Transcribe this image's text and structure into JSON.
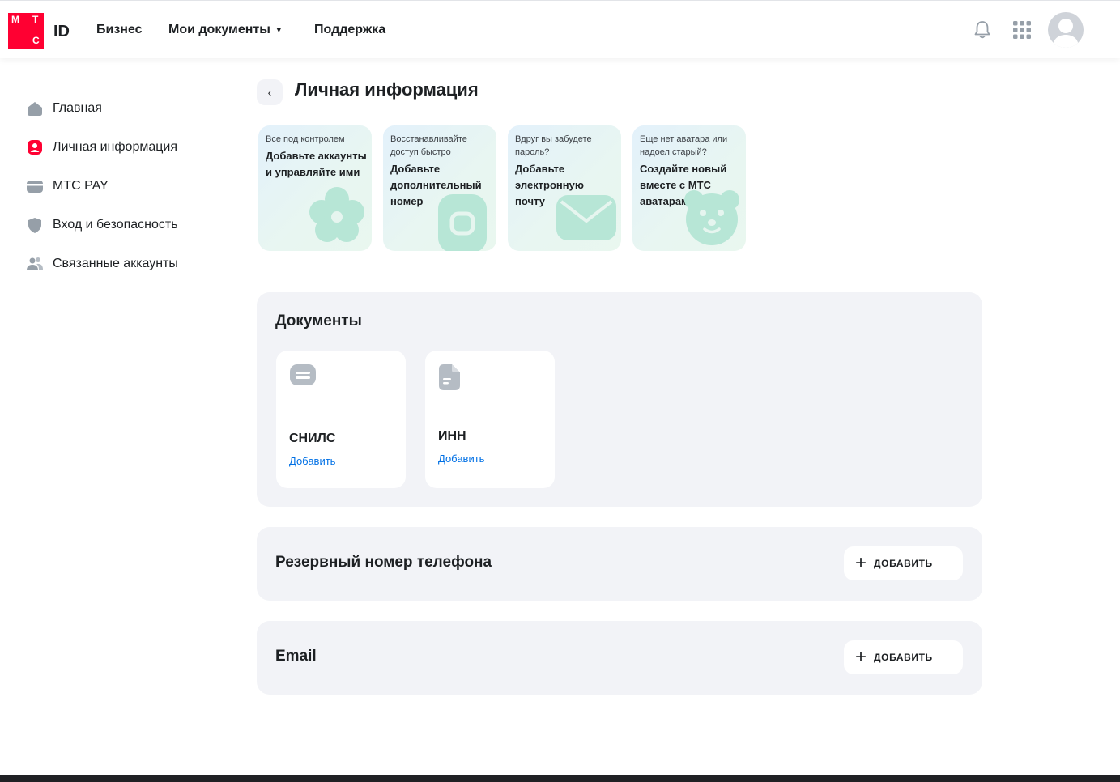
{
  "header": {
    "logo_letters": [
      "М",
      "Т",
      "С"
    ],
    "logo_id": "ID",
    "nav": [
      {
        "label": "Бизнес"
      },
      {
        "label": "Мои документы",
        "has_dropdown": true
      },
      {
        "label": "Поддержка"
      }
    ],
    "icons": [
      "bell-icon",
      "apps-grid-icon",
      "avatar"
    ]
  },
  "sidebar": {
    "items": [
      {
        "label": "Главная",
        "icon": "home-icon"
      },
      {
        "label": "Личная информация",
        "icon": "user-icon",
        "active": true
      },
      {
        "label": "МТС PAY",
        "icon": "card-icon"
      },
      {
        "label": "Вход и безопасность",
        "icon": "shield-icon"
      },
      {
        "label": "Связанные аккаунты",
        "icon": "users-icon"
      }
    ]
  },
  "page": {
    "title": "Личная информация",
    "back_icon": "chevron-left-icon"
  },
  "promos": [
    {
      "small": "Все под контролем",
      "big": "Добавьте аккаунты и управляйте ими",
      "icon": "flower-icon"
    },
    {
      "small": "Восстанавливайте доступ быстро",
      "big": "Добавьте дополнительный номер",
      "icon": "phone-icon"
    },
    {
      "small": "Вдруг вы забудете пароль?",
      "big": "Добавьте электронную почту",
      "icon": "envelope-icon"
    },
    {
      "small": "Еще нет аватара или надоел старый?",
      "big": "Создайте новый вместе с МТС аватарами",
      "icon": "bear-icon"
    }
  ],
  "documents": {
    "title": "Документы",
    "cards": [
      {
        "name": "СНИЛС",
        "action": "Добавить",
        "icon": "snils-card-icon"
      },
      {
        "name": "ИНН",
        "action": "Добавить",
        "icon": "document-icon"
      }
    ]
  },
  "backup_phone": {
    "title": "Резервный номер телефона",
    "button": "ДОБАВИТЬ"
  },
  "email": {
    "title": "Email",
    "button": "ДОБАВИТЬ"
  },
  "colors": {
    "brand": "#ff0032",
    "link": "#0070e5",
    "section_bg": "#f2f3f7",
    "icon_gray": "#969fa8",
    "promo_icon": "#b7e6d6"
  }
}
